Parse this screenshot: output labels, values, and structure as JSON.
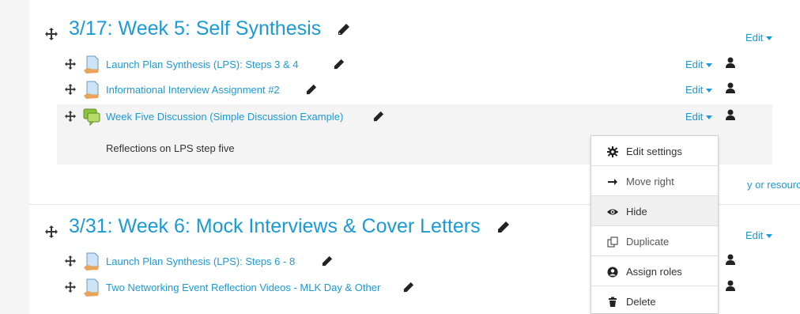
{
  "sections": [
    {
      "title": "3/17: Week 5: Self Synthesis",
      "edit": "Edit",
      "activities": [
        {
          "label": "Launch Plan Synthesis (LPS): Steps 3 & 4",
          "edit": "Edit",
          "icon": "assignment-icon"
        },
        {
          "label": "Informational Interview Assignment #2",
          "edit": "Edit",
          "icon": "assignment-icon"
        },
        {
          "label": "Week Five Discussion (Simple Discussion Example)",
          "edit": "Edit",
          "icon": "forum-icon",
          "description": "Reflections on LPS step five"
        }
      ],
      "add_link": "y or resource"
    },
    {
      "title": "3/31: Week 6: Mock Interviews & Cover Letters",
      "edit": "Edit",
      "activities": [
        {
          "label": "Launch Plan Synthesis (LPS): Steps 6 - 8",
          "icon": "assignment-icon"
        },
        {
          "label": "Two Networking Event Reflection Videos - MLK Day & Other",
          "icon": "assignment-icon"
        }
      ]
    }
  ],
  "menu": {
    "items": [
      {
        "label": "Edit settings",
        "icon": "gear-icon"
      },
      {
        "label": "Move right",
        "icon": "arrow-right-icon"
      },
      {
        "label": "Hide",
        "icon": "eye-icon"
      },
      {
        "label": "Duplicate",
        "icon": "copy-icon"
      },
      {
        "label": "Assign roles",
        "icon": "user-circle-icon"
      },
      {
        "label": "Delete",
        "icon": "trash-icon"
      }
    ]
  },
  "colors": {
    "link": "#1a9ad6",
    "text": "#333333",
    "highlight": "#f4f4f4"
  }
}
